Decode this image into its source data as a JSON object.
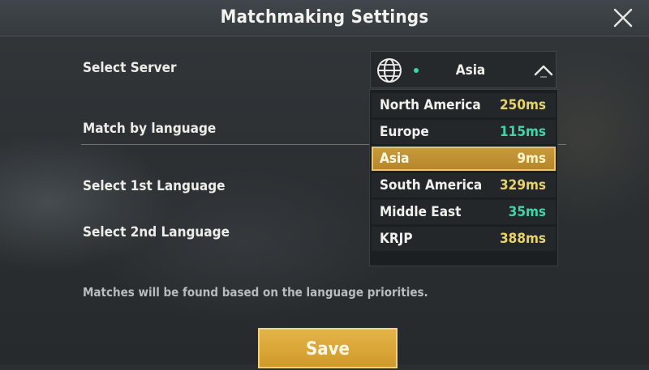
{
  "header": {
    "title": "Matchmaking Settings",
    "close_icon": "close-icon"
  },
  "rows": {
    "server_label": "Select Server",
    "language_match_label": "Match by language",
    "first_language_label": "Select 1st Language",
    "second_language_label": "Select 2nd Language"
  },
  "server_select": {
    "icon": "globe-icon",
    "status_color": "#3ad6a2",
    "value": "Asia",
    "chevron_icon": "chevron-up-icon",
    "options": [
      {
        "name": "North America",
        "ping": "250ms",
        "ping_color": "#e7d36a",
        "selected": false
      },
      {
        "name": "Europe",
        "ping": "115ms",
        "ping_color": "#3fd6a6",
        "selected": false
      },
      {
        "name": "Asia",
        "ping": "9ms",
        "ping_color": "#3fd6a6",
        "selected": true
      },
      {
        "name": "South America",
        "ping": "329ms",
        "ping_color": "#e7d36a",
        "selected": false
      },
      {
        "name": "Middle East",
        "ping": "35ms",
        "ping_color": "#3fd6a6",
        "selected": false
      },
      {
        "name": "KRJP",
        "ping": "388ms",
        "ping_color": "#e7d36a",
        "selected": false
      }
    ]
  },
  "hint": "Matches will be found based on the language priorities.",
  "save_label": "Save",
  "accent_color": "#d9a63a"
}
